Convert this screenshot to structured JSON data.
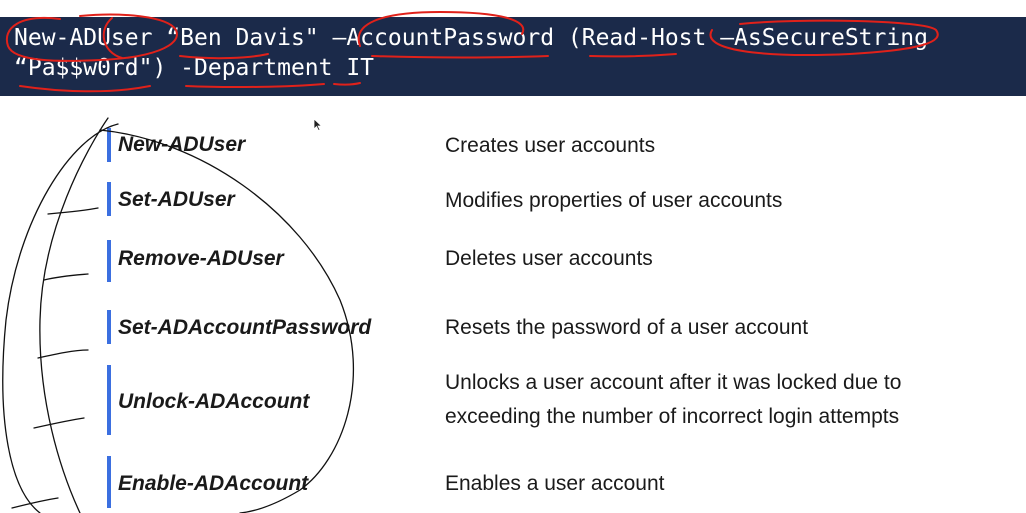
{
  "command_example": {
    "line1": "New-ADUser “Ben Davis\" –AccountPassword (Read-Host –AsSecureString",
    "line2": "“Pa$$w0rd\") -Department IT"
  },
  "cmdlets": [
    {
      "name": "New-ADUser",
      "description": "Creates user accounts"
    },
    {
      "name": "Set-ADUser",
      "description": "Modifies properties of user accounts"
    },
    {
      "name": "Remove-ADUser",
      "description": "Deletes user accounts"
    },
    {
      "name": "Set-ADAccountPassword",
      "description": "Resets the password of a user account"
    },
    {
      "name": "Unlock-ADAccount",
      "description_line1": "Unlocks a user account after it was locked due to",
      "description_line2": "exceeding the number of incorrect login attempts"
    },
    {
      "name": "Enable-ADAccount",
      "description": "Enables a user account"
    }
  ],
  "colors": {
    "banner_bg": "#1b2a4a",
    "accent_bar": "#3b6fe0",
    "annotation_ink": "#e0211a",
    "handwriting_ink": "#111111"
  },
  "icons": {
    "cursor": "mouse-pointer-icon"
  }
}
